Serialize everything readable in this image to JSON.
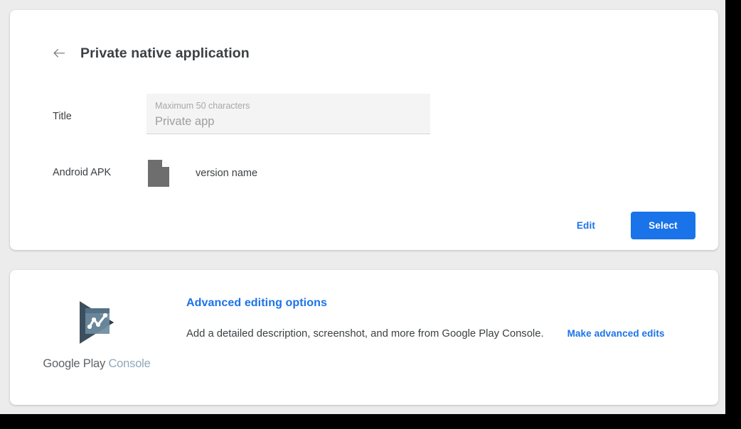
{
  "colors": {
    "accent": "#1a73e8",
    "page_background": "#ececec",
    "card_background": "#ffffff",
    "text_primary": "#3c4043",
    "field_background": "#f4f4f4",
    "file_icon": "#6e6e6e",
    "logo_play": "#3c4f5e",
    "logo_panel": "#6d8ba0",
    "wordmark_google_play": "#5f6368",
    "wordmark_console": "#8fa9bd"
  },
  "app_card": {
    "back_icon": "arrow-left-icon",
    "title": "Private native application",
    "title_field": {
      "label": "Title",
      "placeholder": "Maximum 50 characters",
      "value": "Private app"
    },
    "apk_field": {
      "label": "Android APK",
      "file_icon": "file-document-icon",
      "version": "version name"
    },
    "actions": {
      "edit_label": "Edit",
      "select_label": "Select"
    }
  },
  "advanced_card": {
    "logo": {
      "icon": "google-play-console-logo",
      "wordmark_primary": "Google Play",
      "wordmark_secondary": "Console"
    },
    "heading": "Advanced editing options",
    "description": "Add a detailed description, screenshot, and more from Google Play Console.",
    "link_label": "Make advanced edits"
  }
}
